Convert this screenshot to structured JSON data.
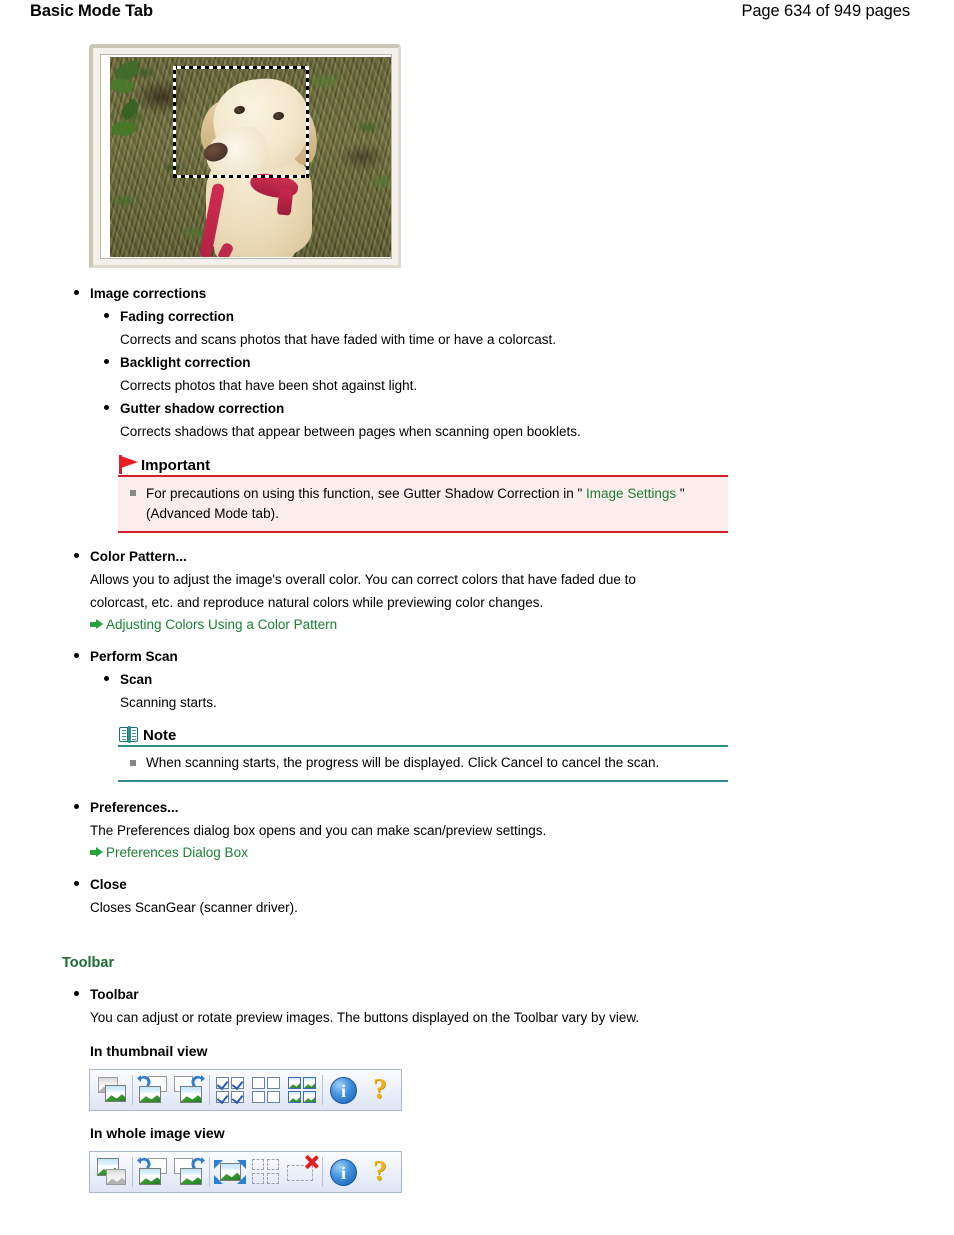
{
  "header": {
    "title": "Basic Mode Tab",
    "page_label": "Page 634 of 949 pages"
  },
  "preview": {
    "name": "scanner-preview-panel",
    "alt": "Scanner preview showing a yellow Labrador dog sitting on grass with a dashed crop selection frame"
  },
  "sections": [
    {
      "term": "Image corrections",
      "children": [
        {
          "term": "Fading correction",
          "desc": "Corrects and scans photos that have faded with time or have a colorcast."
        },
        {
          "term": "Backlight correction",
          "desc": "Corrects photos that have been shot against light."
        },
        {
          "term": "Gutter shadow correction",
          "desc": "Corrects shadows that appear between pages when scanning open booklets."
        }
      ]
    }
  ],
  "important": {
    "icon": "red-flag-icon",
    "title": "Important",
    "text_before": "For precautions on using this function, see Gutter Shadow Correction in \"",
    "link": "Image Settings",
    "text_after": "\" (Advanced Mode tab)."
  },
  "color_pattern": {
    "term": "Color Pattern...",
    "desc_line1": "Allows you to adjust the image's overall color. You can correct colors that have faded due to",
    "desc_line2": "colorcast, etc. and reproduce natural colors while previewing color changes.",
    "link": "Adjusting Colors Using a Color Pattern"
  },
  "perform_scan": {
    "term": "Perform Scan",
    "child_term": "Scan",
    "child_desc": "Scanning starts."
  },
  "note": {
    "icon": "open-book-icon",
    "title": "Note",
    "text": "When scanning starts, the progress will be displayed. Click Cancel to cancel the scan."
  },
  "preferences": {
    "term": "Preferences...",
    "desc": "The Preferences dialog box opens and you can make scan/preview settings.",
    "link": "Preferences Dialog Box"
  },
  "close": {
    "term": "Close",
    "desc": "Closes ScanGear (scanner driver)."
  },
  "toolbar_section": {
    "heading": "Toolbar",
    "term": "Toolbar",
    "desc": "You can adjust or rotate preview images. The buttons displayed on the Toolbar vary by view.",
    "thumbnail_label": "In thumbnail view",
    "whole_image_label": "In whole image view",
    "thumbnail_buttons": [
      {
        "name": "clear-image-button",
        "icon": "clear-image-icon"
      },
      {
        "name": "rotate-left-button",
        "icon": "rotate-left-icon"
      },
      {
        "name": "rotate-right-button",
        "icon": "rotate-right-icon"
      },
      {
        "name": "select-all-frames-button",
        "icon": "checked-grid-icon"
      },
      {
        "name": "deselect-all-frames-button",
        "icon": "unchecked-grid-icon"
      },
      {
        "name": "select-all-thumbnails-button",
        "icon": "thumbnail-grid-icon"
      },
      {
        "name": "information-button",
        "icon": "info-icon"
      },
      {
        "name": "help-button",
        "icon": "help-question-icon"
      }
    ],
    "whole_image_buttons": [
      {
        "name": "clear-image-button",
        "icon": "clear-image-icon"
      },
      {
        "name": "rotate-left-button",
        "icon": "rotate-left-icon"
      },
      {
        "name": "rotate-right-button",
        "icon": "rotate-right-icon"
      },
      {
        "name": "auto-crop-button",
        "icon": "auto-crop-icon"
      },
      {
        "name": "multi-crop-button",
        "icon": "multi-crop-icon"
      },
      {
        "name": "remove-crop-frame-button",
        "icon": "remove-crop-icon"
      },
      {
        "name": "information-button",
        "icon": "info-icon"
      },
      {
        "name": "help-button",
        "icon": "help-question-icon"
      }
    ]
  },
  "colors": {
    "link_green": "#1a7f34",
    "heading_green": "#1d6b33",
    "important_border": "#d62027",
    "important_bg": "#fceded",
    "note_border": "#2d8b8b"
  }
}
